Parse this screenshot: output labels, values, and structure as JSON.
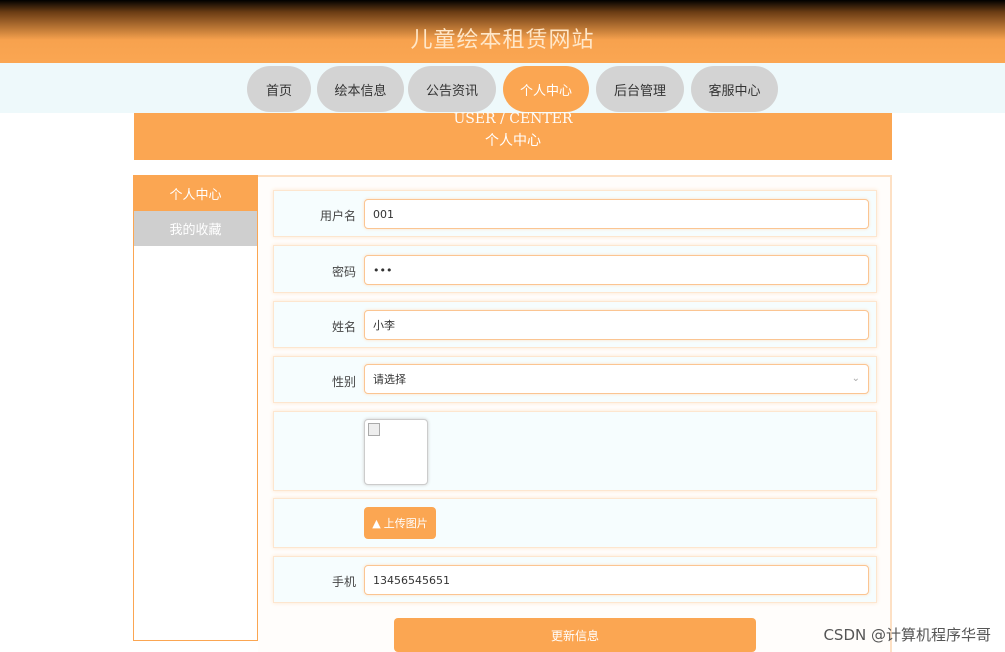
{
  "site": {
    "title": "儿童绘本租赁网站"
  },
  "nav": [
    {
      "label": "首页"
    },
    {
      "label": "绘本信息"
    },
    {
      "label": "公告资讯"
    },
    {
      "label": "个人中心"
    },
    {
      "label": "后台管理"
    },
    {
      "label": "客服中心"
    }
  ],
  "banner": {
    "en": "USER / CENTER",
    "cn": "个人中心"
  },
  "sidebar": {
    "items": [
      {
        "label": "个人中心"
      },
      {
        "label": "我的收藏"
      }
    ]
  },
  "form": {
    "username": {
      "label": "用户名",
      "value": "001"
    },
    "password": {
      "label": "密码",
      "value": "•••"
    },
    "name": {
      "label": "姓名",
      "value": "小李"
    },
    "gender": {
      "label": "性别",
      "value": "请选择"
    },
    "upload_label": "上传图片",
    "phone": {
      "label": "手机",
      "value": "13456545651"
    },
    "submit_label": "更新信息"
  },
  "watermark": "CSDN @计算机程序华哥",
  "colors": {
    "accent": "#fba652",
    "inactive_nav": "#d3d3d3"
  }
}
